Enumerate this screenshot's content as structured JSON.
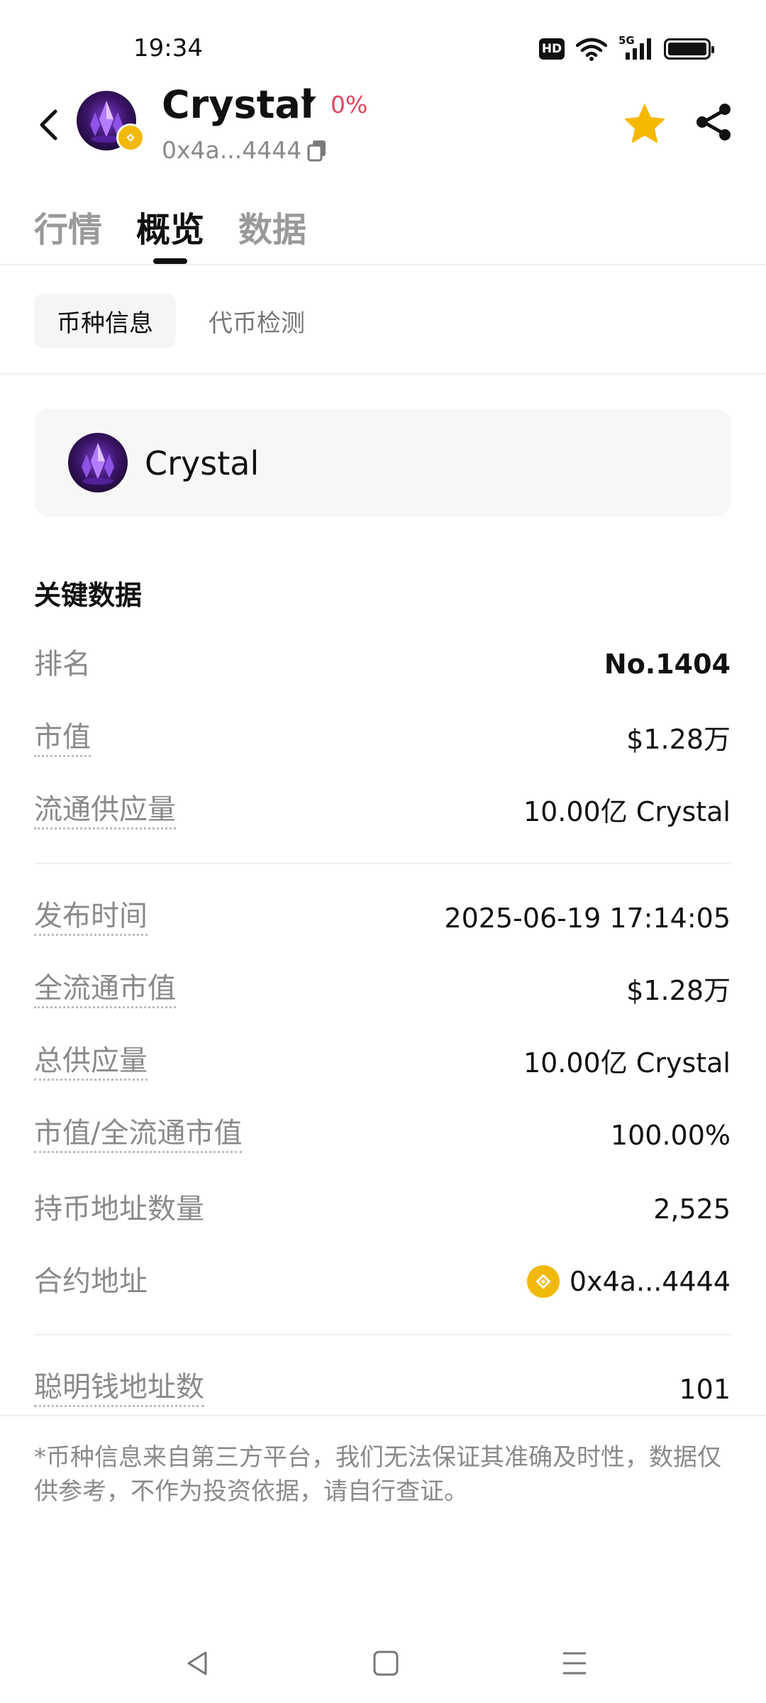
{
  "status_bar": {
    "time": "19:34",
    "network": "5G",
    "hd_label": "HD"
  },
  "header": {
    "token_name": "Crystal",
    "change_pct": "0%",
    "address": "0x4a...4444",
    "favorited": true
  },
  "tabs": [
    {
      "label": "行情",
      "active": false
    },
    {
      "label": "概览",
      "active": true
    },
    {
      "label": "数据",
      "active": false
    }
  ],
  "subtabs": [
    {
      "label": "币种信息",
      "active": true
    },
    {
      "label": "代币检测",
      "active": false
    }
  ],
  "card": {
    "name": "Crystal"
  },
  "key_data": {
    "title": "关键数据",
    "rows": [
      {
        "label": "排名",
        "value": "No.1404"
      },
      {
        "label": "市值",
        "value": "$1.28万"
      },
      {
        "label": "流通供应量",
        "value": "10.00亿 Crystal"
      },
      {
        "label": "发布时间",
        "value": "2025-06-19 17:14:05"
      },
      {
        "label": "全流通市值",
        "value": "$1.28万"
      },
      {
        "label": "总供应量",
        "value": "10.00亿 Crystal"
      },
      {
        "label": "市值/全流通市值",
        "value": "100.00%"
      },
      {
        "label": "持币地址数量",
        "value": "2,525"
      },
      {
        "label": "合约地址",
        "value": "0x4a...4444"
      },
      {
        "label": "聪明钱地址数",
        "value": "101"
      }
    ]
  },
  "disclaimer": "*币种信息来自第三方平台，我们无法保证其准确及时性，数据仅供参考，不作为投资依据，请自行查证。",
  "colors": {
    "accent_negative": "#e0465e",
    "star": "#f5b800",
    "bnb": "#f0b90b"
  }
}
